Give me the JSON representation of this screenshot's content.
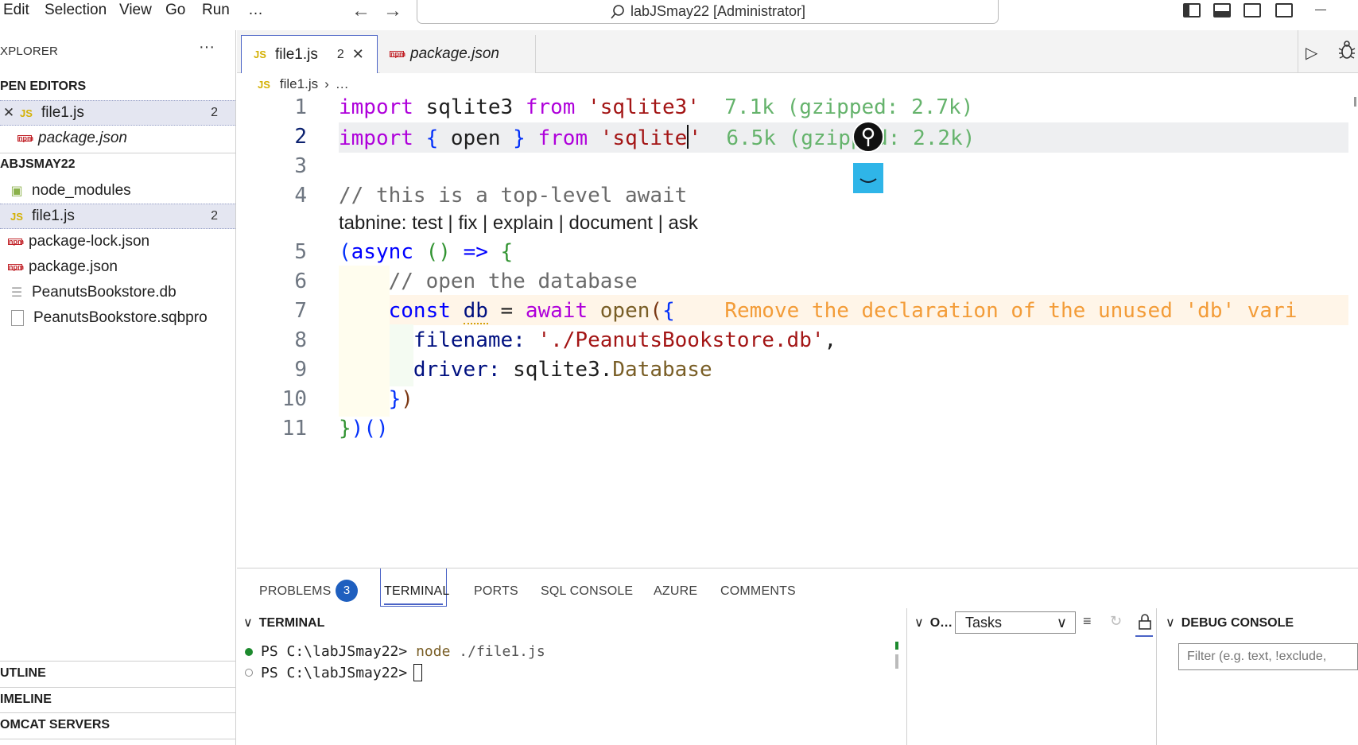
{
  "menubar": {
    "items": [
      "Edit",
      "Selection",
      "View",
      "Go",
      "Run",
      "…"
    ],
    "search_text": "labJSmay22 [Administrator]"
  },
  "sidebar": {
    "title": "XPLORER",
    "more": "···",
    "open_editors": {
      "header": "PEN EDITORS",
      "items": [
        {
          "label": "file1.js",
          "badge": "2"
        },
        {
          "label": "package.json"
        }
      ]
    },
    "workspace": {
      "header": "ABJSMAY22",
      "items": [
        {
          "label": "node_modules"
        },
        {
          "label": "file1.js",
          "badge": "2"
        },
        {
          "label": "package-lock.json"
        },
        {
          "label": "package.json"
        },
        {
          "label": "PeanutsBookstore.db"
        },
        {
          "label": "PeanutsBookstore.sqbpro"
        }
      ]
    },
    "outline": "UTLINE",
    "timeline": "IMELINE",
    "tomcat": "OMCAT SERVERS"
  },
  "tabs": [
    {
      "label": "file1.js",
      "count": "2",
      "close": "✕"
    },
    {
      "label": "package.json"
    }
  ],
  "breadcrumb": {
    "file": "file1.js",
    "rest": "…"
  },
  "editor": {
    "line_numbers": [
      "1",
      "2",
      "3",
      "4",
      "5",
      "6",
      "7",
      "8",
      "9",
      "10",
      "11"
    ],
    "tabnine_lens": "tabnine: test | fix | explain | document | ask",
    "l1": {
      "import": "import",
      "name": "sqlite3",
      "from": "from",
      "str": "'sqlite3'",
      "hint": "7.1k (gzipped: 2.7k)"
    },
    "l2": {
      "import": "import",
      "ob": "{",
      "name": "open",
      "cb": "}",
      "from": "from",
      "str_a": "'sqlite",
      "str_b": "'",
      "hint": "6.5k (gzipped: 2.2k)"
    },
    "l4": {
      "comment": "// this is a top-level await"
    },
    "l5": {
      "op": "(",
      "async": "async",
      "p": "()",
      "arrow": "=>",
      "brace": "{"
    },
    "l6": {
      "comment": "// open the database"
    },
    "l7": {
      "const": "const",
      "db": "db",
      "eq": "=",
      "await": "await",
      "open": "open",
      "paren": "(",
      "brace": "{",
      "diag": "Remove the declaration of the unused 'db' vari"
    },
    "l8": {
      "key": "filename:",
      "str": "'./PeanutsBookstore.db'",
      "comma": ","
    },
    "l9": {
      "key": "driver:",
      "obj": "sqlite3",
      "dot": ".",
      "prop": "Database"
    },
    "l10": {
      "brace": "}",
      "paren": ")"
    },
    "l11": {
      "brace": "}",
      "paren": ")",
      "call": "()"
    }
  },
  "panel": {
    "tabs": [
      "PROBLEMS",
      "TERMINAL",
      "PORTS",
      "SQL CONSOLE",
      "AZURE",
      "COMMENTS"
    ],
    "problems_count": "3",
    "terminal_header": "TERMINAL",
    "terminal_lines": [
      {
        "prompt": "PS C:\\labJSmay22>",
        "cmd": "node",
        "arg": "./file1.js"
      },
      {
        "prompt": "PS C:\\labJSmay22>"
      }
    ],
    "output_header": "O…",
    "tasks_value": "Tasks",
    "debug_header": "DEBUG CONSOLE",
    "filter_placeholder": "Filter (e.g. text, !exclude,"
  },
  "colors": {
    "accent": "#4a63c6",
    "keyword": "#af00db",
    "string": "#a31515",
    "size_hint": "#65b36c",
    "diagnostic": "#f39c38"
  }
}
